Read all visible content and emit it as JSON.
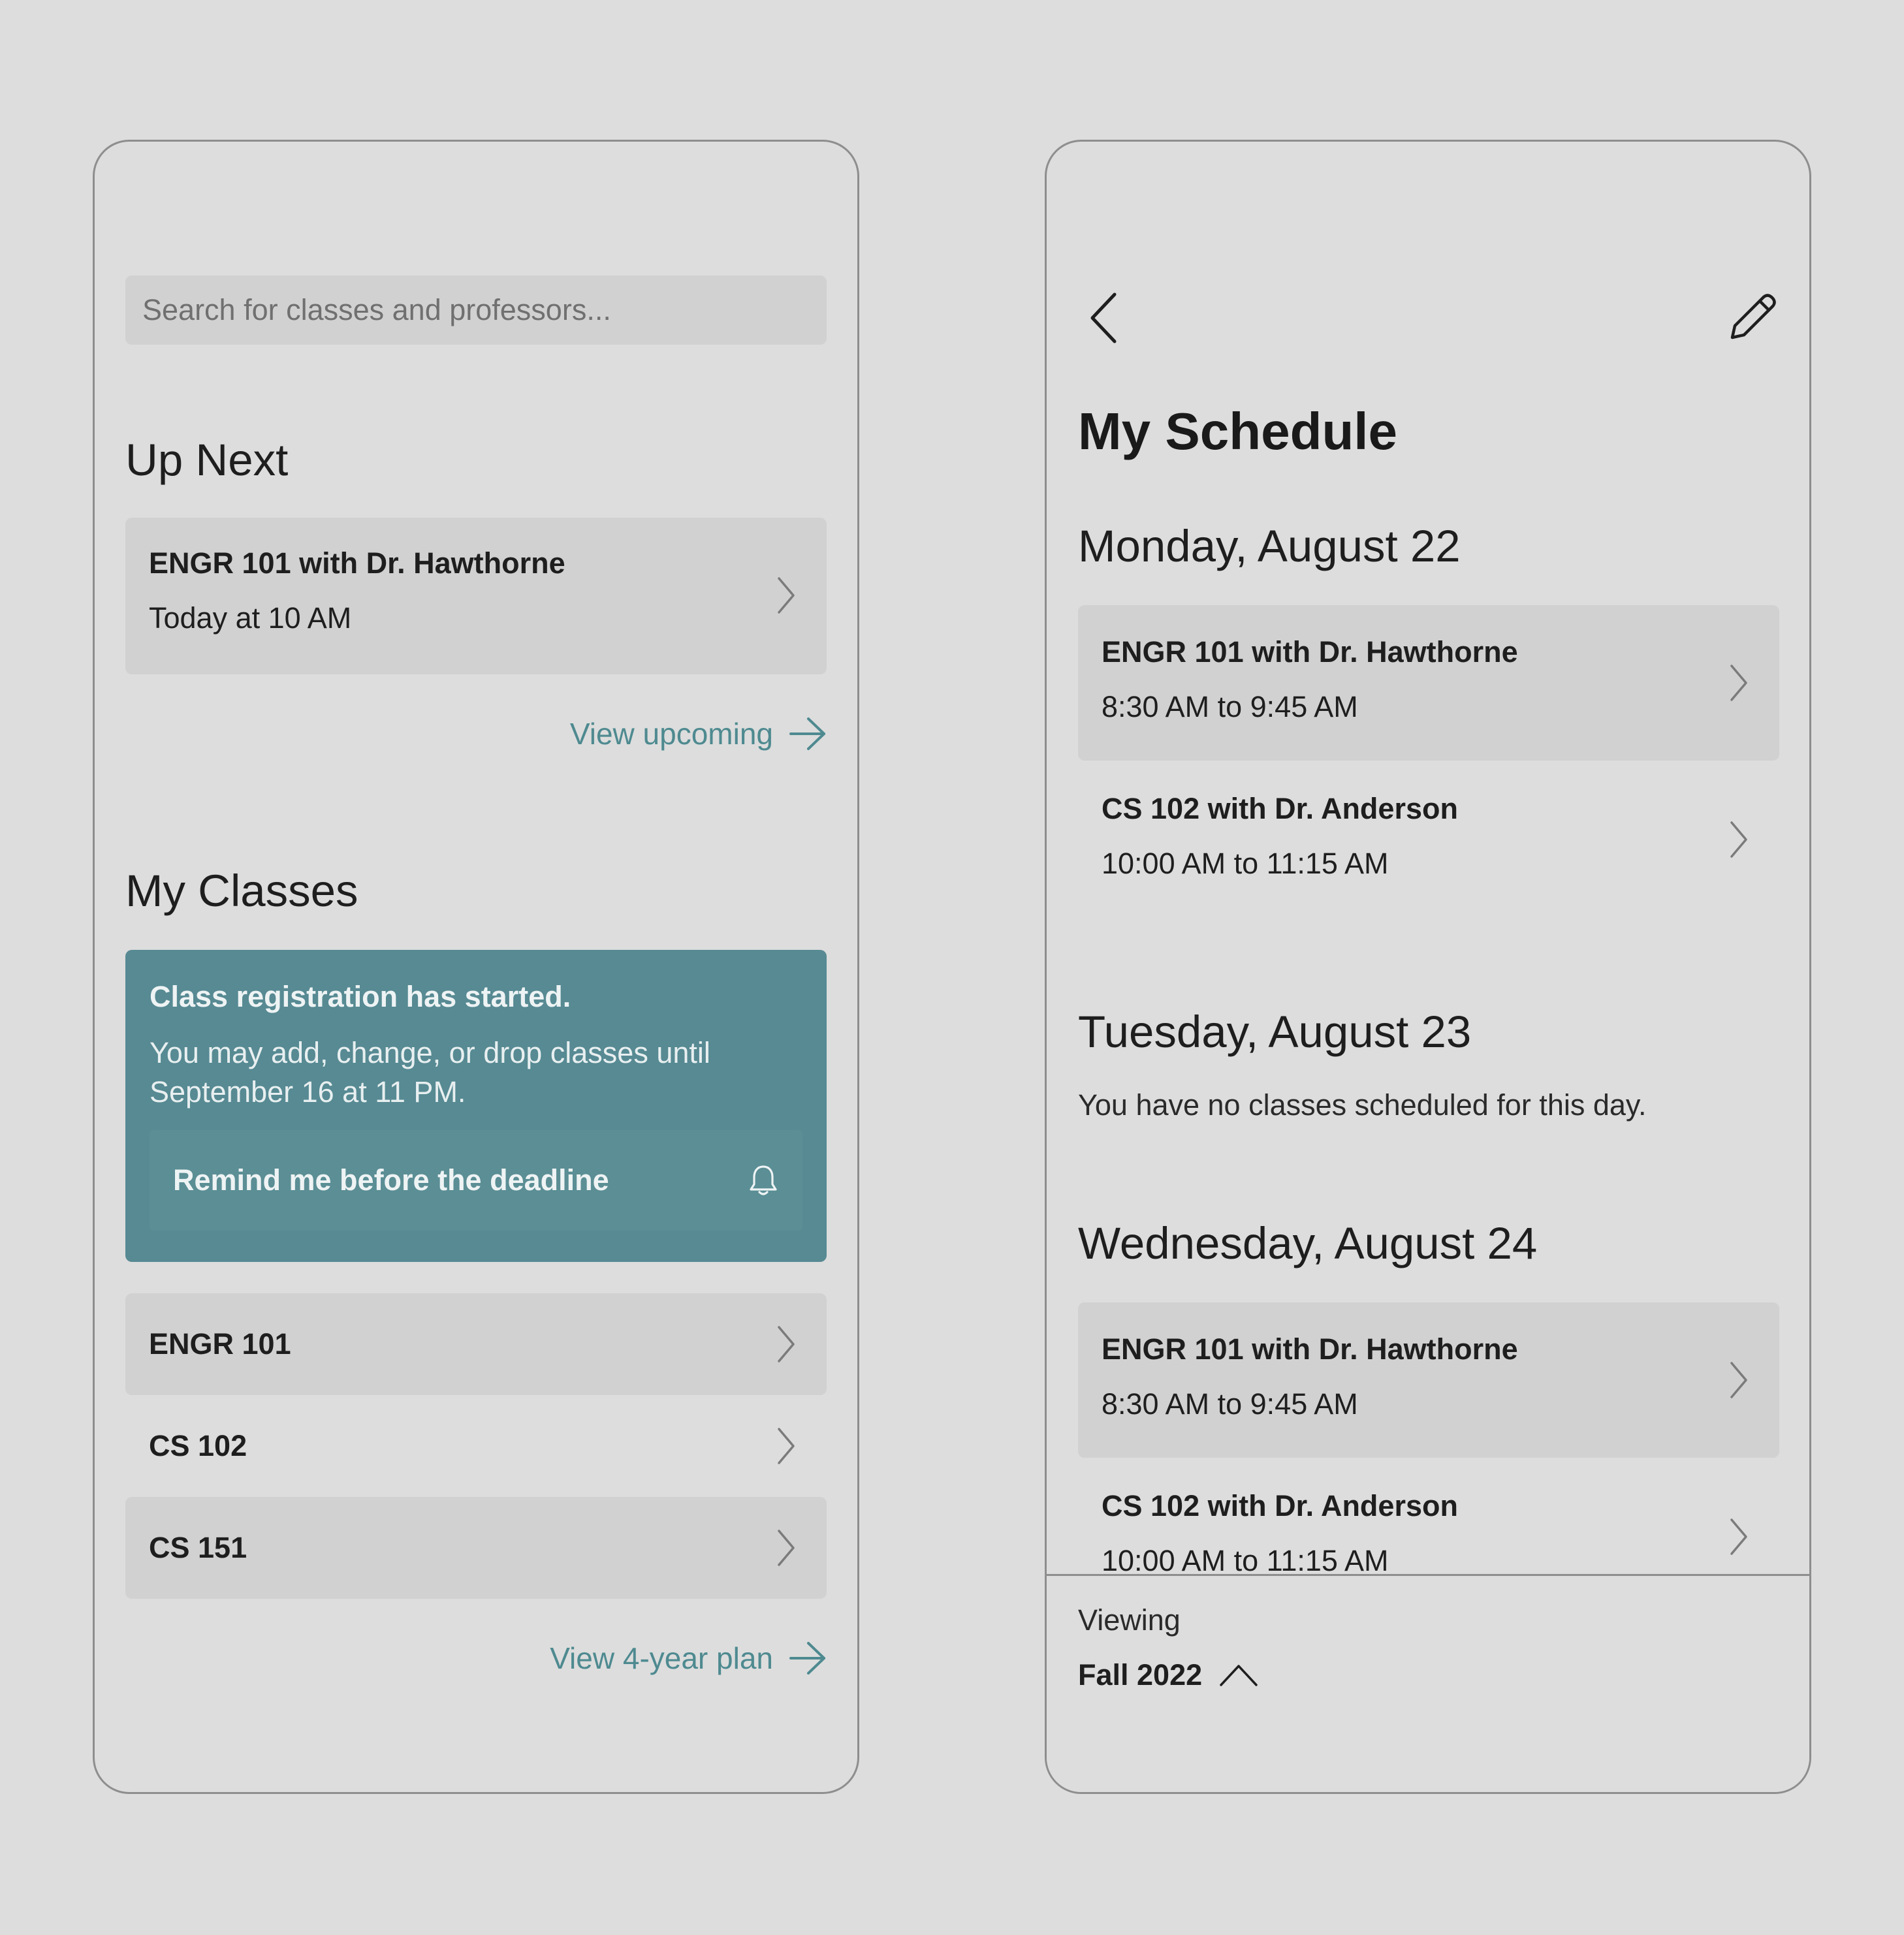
{
  "home": {
    "search": {
      "placeholder": "Search for classes and professors..."
    },
    "up_next": {
      "heading": "Up Next",
      "card": {
        "title": "ENGR 101 with Dr. Hawthorne",
        "time": "Today at 10 AM"
      },
      "view_link": "View upcoming"
    },
    "my_classes": {
      "heading": "My Classes",
      "banner": {
        "title": "Class registration has started.",
        "message": "You may add, change, or drop classes until September 16 at 11 PM.",
        "remind_label": "Remind me before the deadline",
        "bg_color": "#578a93"
      },
      "classes": [
        {
          "label": "ENGR 101"
        },
        {
          "label": "CS 102"
        },
        {
          "label": "CS 151"
        }
      ],
      "plan_link": "View 4-year plan"
    }
  },
  "schedule": {
    "title": "My Schedule",
    "days": [
      {
        "heading": "Monday, August 22",
        "classes": [
          {
            "title": "ENGR 101 with Dr. Hawthorne",
            "time": "8:30 AM to 9:45 AM"
          },
          {
            "title": "CS 102 with Dr. Anderson",
            "time": "10:00 AM to 11:15 AM"
          }
        ]
      },
      {
        "heading": "Tuesday, August 23",
        "empty_message": "You have no classes scheduled for this day."
      },
      {
        "heading": "Wednesday, August 24",
        "classes": [
          {
            "title": "ENGR 101 with Dr. Hawthorne",
            "time": "8:30 AM to 9:45 AM"
          },
          {
            "title": "CS 102 with Dr. Anderson",
            "time": "10:00 AM to 11:15 AM"
          }
        ]
      }
    ],
    "footer": {
      "label": "Viewing",
      "term": "Fall 2022"
    }
  },
  "colors": {
    "accent": "#4e8a90",
    "banner": "#578a93",
    "card": "#d1d1d1",
    "background": "#dddddd"
  },
  "icons": [
    "chevron-right-icon",
    "arrow-right-icon",
    "bell-icon",
    "back-chevron-icon",
    "pencil-icon",
    "chevron-up-icon"
  ]
}
